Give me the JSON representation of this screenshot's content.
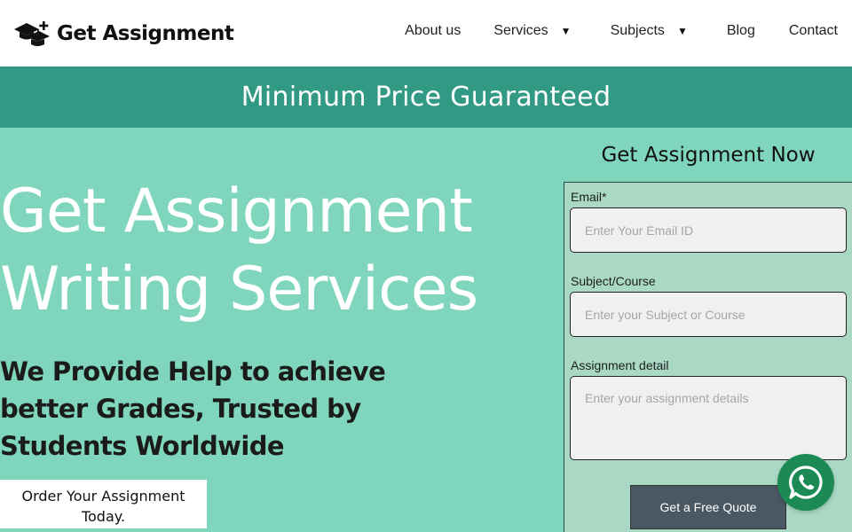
{
  "header": {
    "logo_text": "Get Assignment",
    "logo_icon": "graduation-cap-plus-icon",
    "nav": {
      "about": "About us",
      "services": "Services",
      "subjects": "Subjects",
      "blog": "Blog",
      "contact": "Contact"
    },
    "caret": "▼"
  },
  "banner": {
    "text": "Minimum Price Guaranteed"
  },
  "hero": {
    "title_line1": "Get Assignment",
    "title_line2": "Writing Services",
    "subtitle": "We Provide Help to achieve better Grades, Trusted by Students Worldwide",
    "order_button": "Order Your Assignment Today."
  },
  "form": {
    "heading": "Get Assignment Now",
    "email_label": "Email*",
    "email_placeholder": "Enter Your Email ID",
    "email_value": "",
    "subject_label": "Subject/Course",
    "subject_placeholder": "Enter your Subject or Course",
    "subject_value": "",
    "detail_label": "Assignment detail",
    "detail_placeholder": "Enter your assignment details",
    "detail_value": "",
    "submit_label": "Get a Free Quote"
  },
  "colors": {
    "page_bg": "#7fd6bd",
    "banner_bg": "#329a84",
    "form_bg": "#a9d9c5",
    "button_bg": "#4a5863",
    "whatsapp_bg": "#1b8a54"
  },
  "whatsapp": {
    "icon": "whatsapp-icon"
  }
}
